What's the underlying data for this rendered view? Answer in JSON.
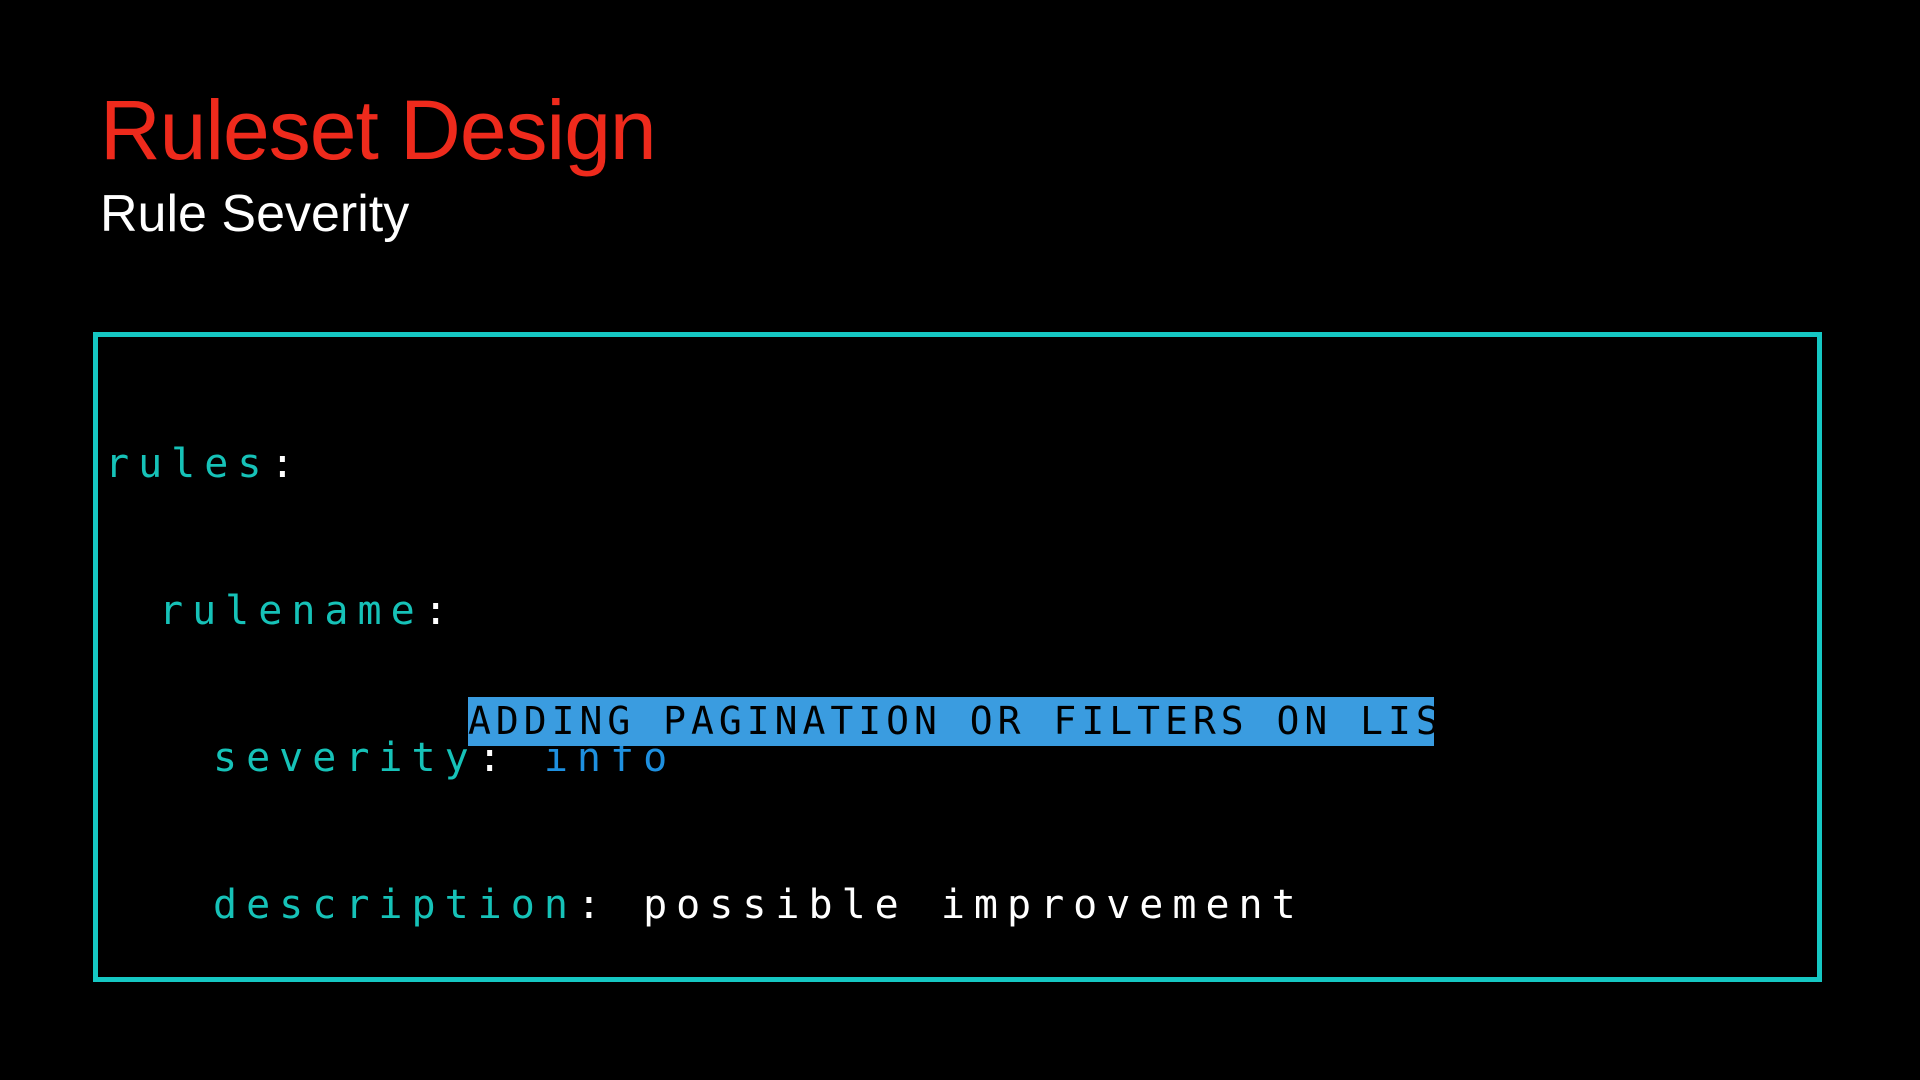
{
  "slide": {
    "title": "Ruleset Design",
    "subtitle": "Rule Severity"
  },
  "code_block": {
    "lines": [
      {
        "key": "rules",
        "colon": ":"
      },
      {
        "key": "rulename",
        "colon": ":"
      },
      {
        "key": "severity",
        "colon": ": ",
        "value": "info"
      },
      {
        "key": "description",
        "colon": ": ",
        "value": "possible improvement"
      }
    ]
  },
  "banner": {
    "text": "ADDING PAGINATION OR FILTERS ON LIST"
  },
  "colors": {
    "background": "#000000",
    "title": "#ee2a1c",
    "subtitle": "#ffffff",
    "box_border": "#15c7c3",
    "yaml_key": "#16c2b8",
    "yaml_value_keyword": "#1e90e0",
    "yaml_value_text": "#ffffff",
    "banner_background": "#3a9ce0",
    "banner_text": "#000000"
  }
}
